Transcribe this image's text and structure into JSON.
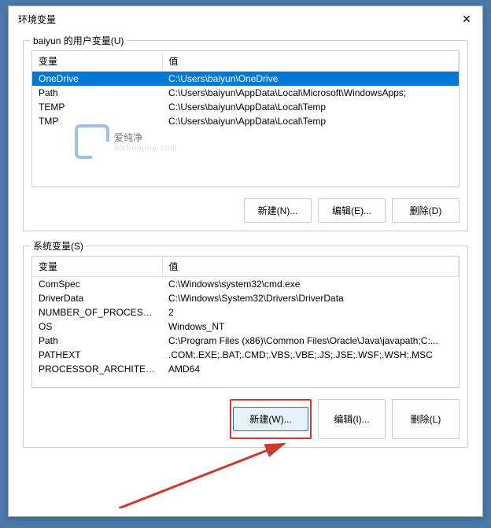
{
  "title": "环境变量",
  "close_symbol": "✕",
  "user_group": {
    "label": "baiyun 的用户变量(U)",
    "headers": {
      "var": "变量",
      "val": "值"
    },
    "rows": [
      {
        "var": "OneDrive",
        "val": "C:\\Users\\baiyun\\OneDrive",
        "selected": true
      },
      {
        "var": "Path",
        "val": "C:\\Users\\baiyun\\AppData\\Local\\Microsoft\\WindowsApps;",
        "selected": false
      },
      {
        "var": "TEMP",
        "val": "C:\\Users\\baiyun\\AppData\\Local\\Temp",
        "selected": false
      },
      {
        "var": "TMP",
        "val": "C:\\Users\\baiyun\\AppData\\Local\\Temp",
        "selected": false
      }
    ],
    "buttons": {
      "new": "新建(N)...",
      "edit": "编辑(E)...",
      "delete": "删除(D)"
    }
  },
  "system_group": {
    "label": "系统变量(S)",
    "headers": {
      "var": "变量",
      "val": "值"
    },
    "rows": [
      {
        "var": "ComSpec",
        "val": "C:\\Windows\\system32\\cmd.exe"
      },
      {
        "var": "DriverData",
        "val": "C:\\Windows\\System32\\Drivers\\DriverData"
      },
      {
        "var": "NUMBER_OF_PROCESSORS",
        "val": "2"
      },
      {
        "var": "OS",
        "val": "Windows_NT"
      },
      {
        "var": "Path",
        "val": "C:\\Program Files (x86)\\Common Files\\Oracle\\Java\\javapath;C:..."
      },
      {
        "var": "PATHEXT",
        "val": ".COM;.EXE;.BAT;.CMD;.VBS;.VBE;.JS;.JSE;.WSF;.WSH;.MSC"
      },
      {
        "var": "PROCESSOR_ARCHITECT...",
        "val": "AMD64"
      }
    ],
    "buttons": {
      "new": "新建(W)...",
      "edit": "编辑(I)...",
      "delete": "删除(L)"
    }
  },
  "watermark": {
    "text": "爱纯净",
    "sub": "aichunjing.com"
  }
}
